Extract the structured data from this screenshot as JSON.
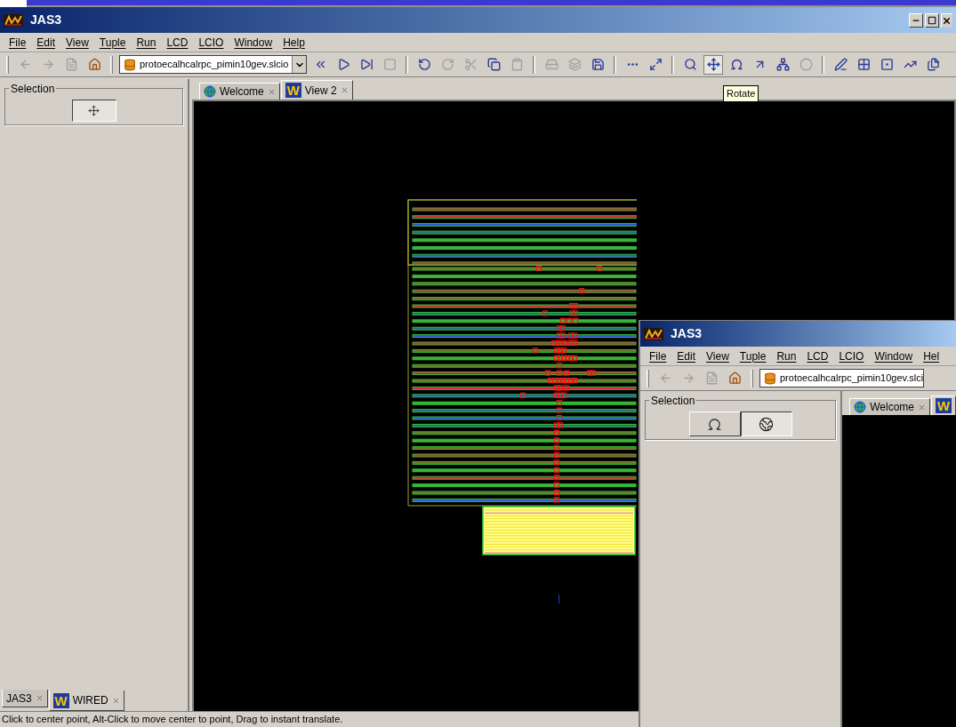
{
  "window": {
    "title": "JAS3"
  },
  "menu": [
    "File",
    "Edit",
    "View",
    "Tuple",
    "Run",
    "LCD",
    "LCIO",
    "Window",
    "Help"
  ],
  "toolbar": [
    {
      "kind": "grip"
    },
    {
      "kind": "back",
      "disabled": true
    },
    {
      "kind": "forward",
      "disabled": true
    },
    {
      "kind": "page",
      "disabled": true
    },
    {
      "kind": "home",
      "disabled": false
    },
    {
      "kind": "grip"
    },
    {
      "kind": "file",
      "value": "protoecalhcalrpc_pimin10gev.slcio",
      "dropdown": true
    },
    {
      "kind": "rewind",
      "disabled": false
    },
    {
      "kind": "play",
      "disabled": false
    },
    {
      "kind": "step",
      "disabled": false
    },
    {
      "kind": "stop",
      "disabled": true
    },
    {
      "kind": "separator"
    },
    {
      "kind": "undo",
      "disabled": false
    },
    {
      "kind": "redo",
      "disabled": true
    },
    {
      "kind": "cut",
      "disabled": true
    },
    {
      "kind": "copy",
      "disabled": false
    },
    {
      "kind": "paste",
      "disabled": true
    },
    {
      "kind": "separator"
    },
    {
      "kind": "disk",
      "disabled": true
    },
    {
      "kind": "disks",
      "disabled": true
    },
    {
      "kind": "save",
      "disabled": false
    },
    {
      "kind": "separator"
    },
    {
      "kind": "dots",
      "disabled": false
    },
    {
      "kind": "fit",
      "disabled": false
    },
    {
      "kind": "separator"
    },
    {
      "kind": "zoom",
      "disabled": false,
      "selected": false
    },
    {
      "kind": "pan",
      "disabled": false,
      "selected": true
    },
    {
      "kind": "rotate",
      "disabled": false,
      "selected": false
    },
    {
      "kind": "pick",
      "disabled": false
    },
    {
      "kind": "tree",
      "disabled": false
    },
    {
      "kind": "angles",
      "disabled": true
    },
    {
      "kind": "separator"
    },
    {
      "kind": "line",
      "disabled": false
    },
    {
      "kind": "boxes",
      "disabled": false
    },
    {
      "kind": "frame",
      "disabled": false
    },
    {
      "kind": "slope",
      "disabled": false
    },
    {
      "kind": "windows",
      "disabled": false
    }
  ],
  "tooltip": "Rotate",
  "selection": {
    "title": "Selection",
    "buttons": [
      {
        "kind": "pan",
        "selected": true
      }
    ]
  },
  "view_tabs": [
    {
      "kind": "globe",
      "label": "Welcome",
      "selected": false
    },
    {
      "kind": "wired",
      "badge": "W",
      "label": "View 2",
      "selected": true
    }
  ],
  "bottom_tabs": [
    {
      "label": "JAS3",
      "selected": false
    },
    {
      "badge": "W",
      "label": "WIRED",
      "selected": true
    }
  ],
  "status_bar": "Click to center point, Alt-Click to move center to point, Drag to instant translate.",
  "second_window": {
    "title": "JAS3",
    "menu": [
      "File",
      "Edit",
      "View",
      "Tuple",
      "Run",
      "LCD",
      "LCIO",
      "Window",
      "Hel"
    ],
    "toolbar": [
      {
        "kind": "grip"
      },
      {
        "kind": "back",
        "disabled": true
      },
      {
        "kind": "forward",
        "disabled": true
      },
      {
        "kind": "page",
        "disabled": true
      },
      {
        "kind": "home",
        "disabled": false
      },
      {
        "kind": "grip"
      },
      {
        "kind": "file",
        "value": "protoecalhcalrpc_pimin10gev.slci",
        "dropdown": false
      }
    ],
    "selection": {
      "title": "Selection",
      "buttons": [
        {
          "kind": "rotate",
          "selected": false
        },
        {
          "kind": "globe3d",
          "selected": true
        }
      ]
    },
    "view_tabs": [
      {
        "kind": "globe",
        "label": "Welcome",
        "selected": false
      },
      {
        "kind": "wired",
        "badge": "W",
        "selected": true
      }
    ]
  }
}
